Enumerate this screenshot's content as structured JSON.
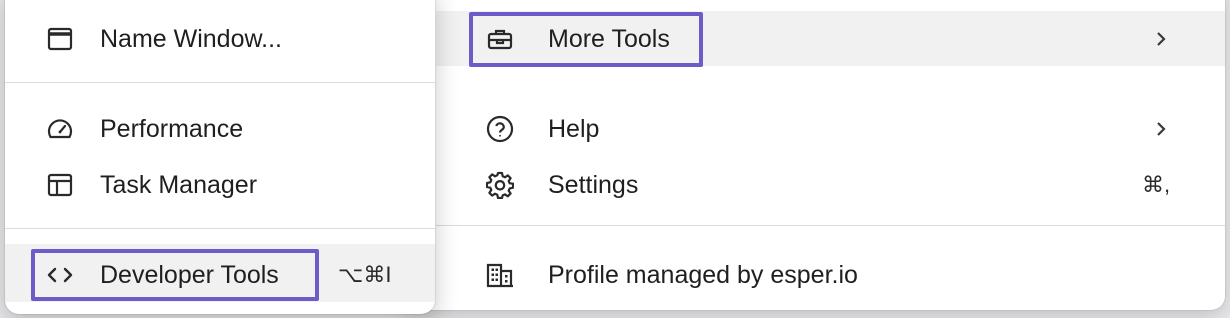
{
  "submenu": {
    "items": [
      {
        "label": "Name Window...",
        "icon": "window-icon"
      },
      {
        "label": "Performance",
        "icon": "gauge-icon"
      },
      {
        "label": "Task Manager",
        "icon": "task-manager-icon"
      },
      {
        "label": "Developer Tools",
        "icon": "code-brackets-icon",
        "shortcut": "⌥⌘I"
      }
    ]
  },
  "main_menu": {
    "items": [
      {
        "label": "More Tools",
        "icon": "toolbox-icon",
        "has_submenu": true
      },
      {
        "label": "Help",
        "icon": "help-icon",
        "has_submenu": true
      },
      {
        "label": "Settings",
        "icon": "gear-icon",
        "shortcut": "⌘,"
      },
      {
        "label": "Profile managed by esper.io",
        "icon": "building-icon"
      }
    ]
  },
  "colors": {
    "focus_outline": "#6d5bc7",
    "hover_background": "#f1f1f2"
  }
}
